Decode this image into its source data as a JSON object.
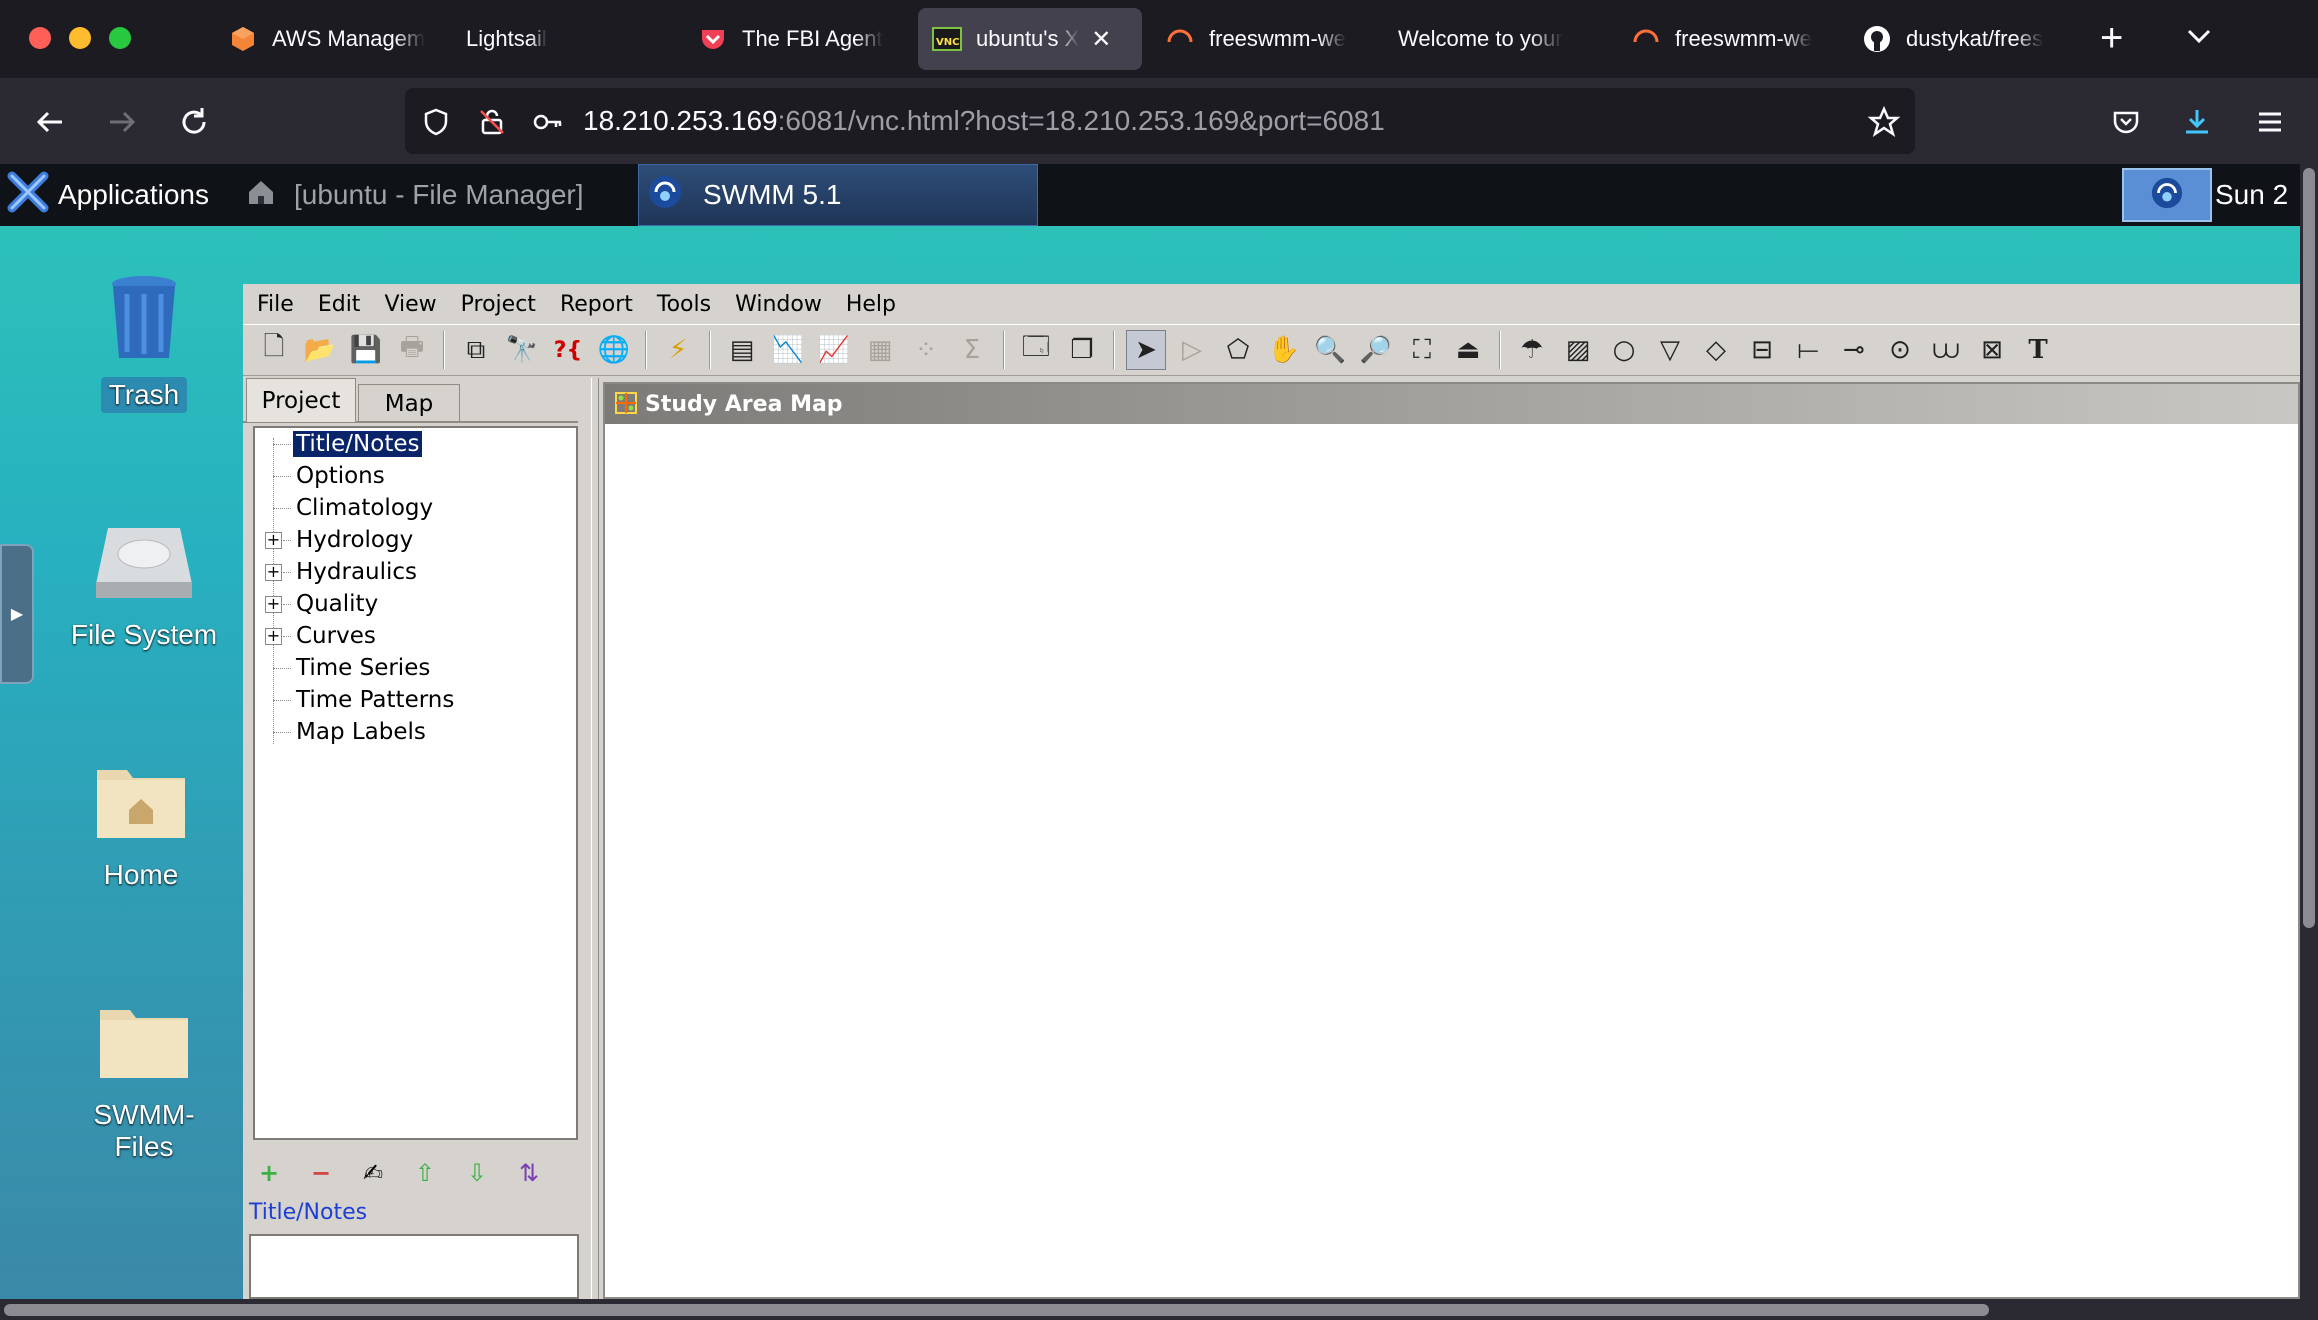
{
  "browser": {
    "tabs": [
      {
        "label": "AWS Managem",
        "icon": "aws-icon",
        "color": "#f58536"
      },
      {
        "label": "Lightsail",
        "icon": "",
        "color": ""
      },
      {
        "label": "The FBI Agent",
        "icon": "pocket-icon",
        "color": "#ef4056"
      },
      {
        "label": "ubuntu's X",
        "icon": "vnc-icon",
        "color": "#2f2f2f"
      },
      {
        "label": "freeswmm-we",
        "icon": "loading-icon",
        "color": "#ff7139"
      },
      {
        "label": "Welcome to your",
        "icon": "",
        "color": ""
      },
      {
        "label": "freeswmm-we",
        "icon": "loading-icon",
        "color": "#ff7139"
      },
      {
        "label": "dustykat/frees",
        "icon": "github-icon",
        "color": "#ffffff"
      }
    ],
    "url_host": "18.210.253.169",
    "url_rest": ":6081/vnc.html?host=18.210.253.169&port=6081"
  },
  "desktop": {
    "panel": {
      "applications_label": "Applications",
      "tasks": [
        "[ubuntu - File Manager]",
        "SWMM 5.1"
      ],
      "clock": "Sun 2"
    },
    "icons": [
      {
        "label": "Trash"
      },
      {
        "label": "File System"
      },
      {
        "label": "Home"
      },
      {
        "label": "SWMM-Files"
      }
    ]
  },
  "swmm": {
    "menu": [
      "File",
      "Edit",
      "View",
      "Project",
      "Report",
      "Tools",
      "Window",
      "Help"
    ],
    "tabs": [
      "Project",
      "Map"
    ],
    "tree": [
      "Title/Notes",
      "Options",
      "Climatology",
      "Hydrology",
      "Hydraulics",
      "Quality",
      "Curves",
      "Time Series",
      "Time Patterns",
      "Map Labels"
    ],
    "selected_item": "Title/Notes",
    "map_title": "Study Area Map"
  },
  "colors": {
    "accent": "#0a246a",
    "browser_bg": "#1c1b22",
    "desktop_teal": "#2ec4b8"
  }
}
